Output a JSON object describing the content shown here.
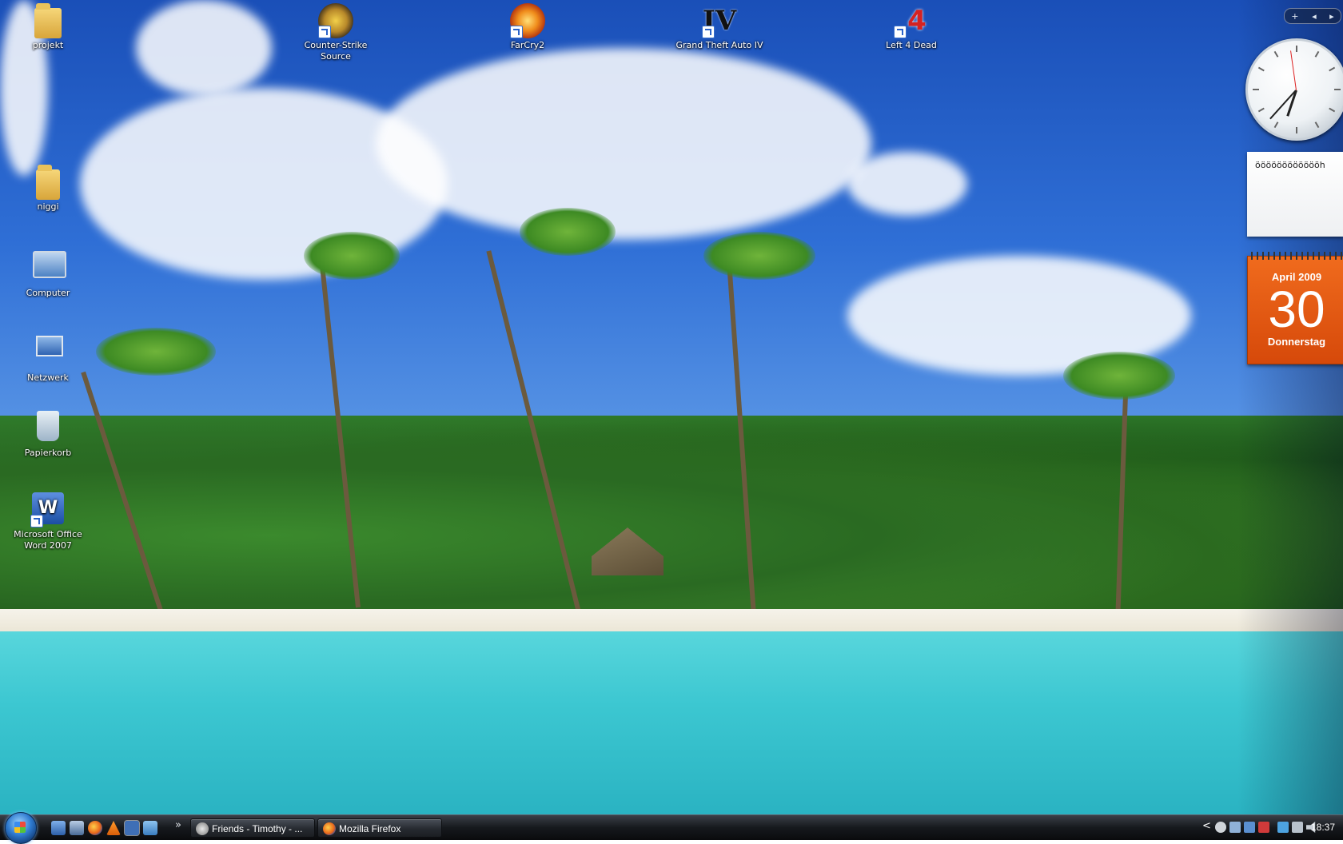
{
  "desktop_icons": [
    {
      "label": "projekt",
      "icon": "folder-icon"
    },
    {
      "label": "niggi",
      "icon": "folder-icon"
    },
    {
      "label": "Computer",
      "icon": "computer-icon"
    },
    {
      "label": "Netzwerk",
      "icon": "network-icon"
    },
    {
      "label": "Papierkorb",
      "icon": "recycle-bin-icon"
    },
    {
      "label": "Microsoft Office Word 2007",
      "icon": "word-icon",
      "glyph": "W"
    },
    {
      "label": "Counter-Strike Source",
      "icon": "counter-strike-icon"
    },
    {
      "label": "FarCry2",
      "icon": "farcry2-icon"
    },
    {
      "label": "Grand Theft Auto IV",
      "icon": "gta-iv-icon",
      "glyph": "IV"
    },
    {
      "label": "Left 4 Dead",
      "icon": "left-4-dead-icon",
      "glyph": "4"
    }
  ],
  "sidebar": {
    "controls": {
      "add": "+",
      "prev": "◂",
      "next": "▸"
    },
    "clock": {
      "hour": 6,
      "minute": 37
    },
    "note": {
      "text": "ööööööööööööh"
    },
    "calendar": {
      "month_year": "April 2009",
      "day": "30",
      "weekday": "Donnerstag"
    }
  },
  "taskbar": {
    "chevron": "»",
    "quick_launch": [
      "show-desktop-icon",
      "switch-windows-icon",
      "firefox-icon",
      "vlc-icon",
      "active-window-icon",
      "app-icon"
    ],
    "tasks": [
      {
        "label": "Friends - Timothy - ...",
        "icon": "steam-icon"
      },
      {
        "label": "Mozilla Firefox",
        "icon": "firefox-icon"
      }
    ],
    "tray": {
      "expand": "<",
      "time": "18:37"
    }
  },
  "colors": {
    "calendar_orange": "#e25a12",
    "taskbar_dark": "#16191d",
    "sea": "#3cc7d1"
  }
}
